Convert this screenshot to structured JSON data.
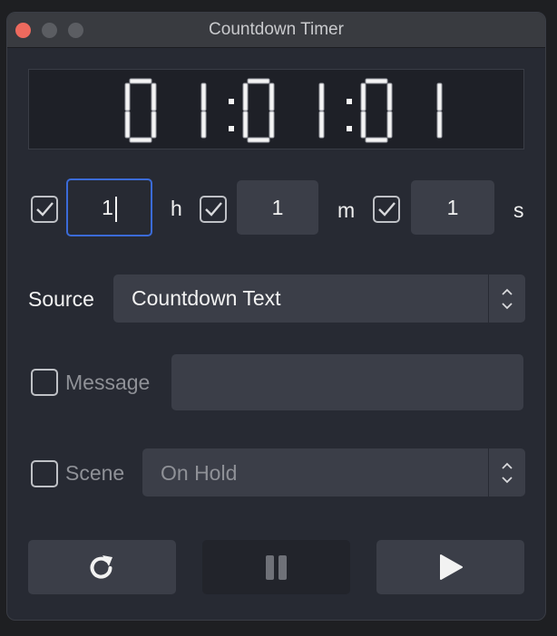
{
  "window": {
    "title": "Countdown Timer"
  },
  "display": {
    "time": "01:01:01"
  },
  "duration": {
    "hours": {
      "checked": true,
      "value": "1",
      "unit": "h"
    },
    "minutes": {
      "checked": true,
      "value": "1",
      "unit": "m"
    },
    "seconds": {
      "checked": true,
      "value": "1",
      "unit": "s"
    }
  },
  "source": {
    "label": "Source",
    "value": "Countdown Text"
  },
  "message": {
    "checked": false,
    "label": "Message",
    "value": ""
  },
  "scene": {
    "checked": false,
    "label": "Scene",
    "value": "On Hold"
  },
  "controls": {
    "reset": "reload-icon",
    "pause": "pause-icon",
    "play": "play-icon"
  },
  "colors": {
    "accent": "#3b6bd8",
    "close": "#ed6a5e"
  }
}
